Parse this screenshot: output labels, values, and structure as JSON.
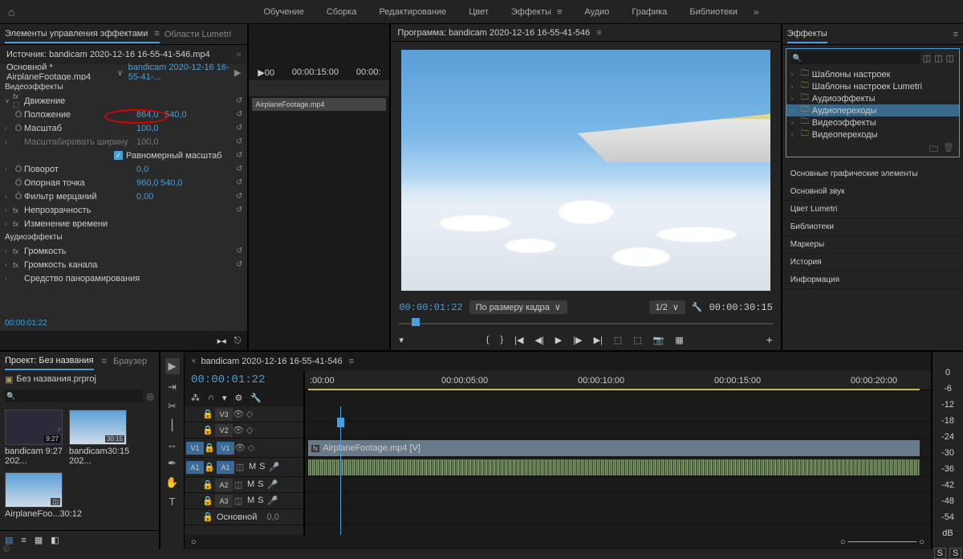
{
  "menu": {
    "items": [
      "Обучение",
      "Сборка",
      "Редактирование",
      "Цвет",
      "Эффекты",
      "Аудио",
      "Графика",
      "Библиотеки"
    ],
    "active": 4
  },
  "panels": {
    "effectControls": {
      "tab": "Элементы управления эффектами",
      "tab2": "Области Lumetri",
      "source": "Источник: bandicam 2020-12-16 16-55-41-546.mp4"
    },
    "crumb": {
      "master": "Основной * AirplaneFootage.mp4",
      "clip": "bandicam 2020-12-16 16-55-41-..."
    },
    "program": {
      "title": "Программа: bandicam 2020-12-16 16-55-41-546"
    },
    "effects": {
      "title": "Эффекты"
    }
  },
  "effects": {
    "videoHeader": "Видеоэффекты",
    "motion": "Движение",
    "position": "Положение",
    "posX": "864,0",
    "posY": "540,0",
    "scale": "Масштаб",
    "scaleV": "100,0",
    "scaleW": "Масштабировать ширину",
    "scaleWV": "100,0",
    "uniform": "Равномерный масштаб",
    "rotation": "Поворот",
    "rotV": "0,0",
    "anchor": "Опорная точка",
    "anchX": "960,0",
    "anchY": "540,0",
    "flicker": "Фильтр мерцаний",
    "flickV": "0,00",
    "opacity": "Непрозрачность",
    "timeremap": "Изменение времени",
    "audioHeader": "Аудиоэффекты",
    "volume": "Громкость",
    "chanVolume": "Громкость канала",
    "panner": "Средство панорамирования"
  },
  "miniTL": {
    "ruler": [
      "▶00",
      "00:00:15:00",
      "00:00:"
    ],
    "clip": "AirplaneFootage.mp4",
    "tc": "00:00:01:22"
  },
  "program": {
    "tc": "00:00:01:22",
    "fit": "По размеру кадра",
    "res": "1/2",
    "dur": "00:00:30:15"
  },
  "fxTree": {
    "items": [
      "Шаблоны настроек",
      "Шаблоны настроек Lumetri",
      "Аудиоэффекты",
      "Аудиопереходы",
      "Видеоэффекты",
      "Видеопереходы"
    ],
    "selected": 3
  },
  "sideTabs": [
    "Основные графические элементы",
    "Основной звук",
    "Цвет Lumetri",
    "Библиотеки",
    "Маркеры",
    "История",
    "Информация"
  ],
  "project": {
    "tab1": "Проект: Без названия",
    "tab2": "Браузер",
    "file": "Без названия.prproj",
    "bins": [
      {
        "name": "bandicam 202...",
        "dur": "9:27"
      },
      {
        "name": "bandicam 202...",
        "dur": "30:15"
      },
      {
        "name": "AirplaneFoo...",
        "dur": "30:12"
      }
    ]
  },
  "timeline": {
    "seq": "bandicam 2020-12-16 16-55-41-546",
    "tc": "00:00:01:22",
    "ruler": [
      ":00:00",
      "00:00:05:00",
      "00:00:10:00",
      "00:00:15:00",
      "00:00:20:00"
    ],
    "tracks": {
      "v3": "V3",
      "v2": "V2",
      "v1": "V1",
      "v1b": "V1",
      "a1": "A1",
      "a1b": "A1",
      "a2": "A2",
      "a3": "A3",
      "master": "Основной",
      "masterV": "0,0"
    },
    "clipV": "AirplaneFootage.mp4 [V]"
  },
  "meter": [
    "0",
    "-6",
    "-12",
    "-18",
    "-24",
    "-30",
    "-36",
    "-42",
    "-48",
    "-54",
    "dB"
  ],
  "meterFoot": [
    "S",
    "S"
  ]
}
